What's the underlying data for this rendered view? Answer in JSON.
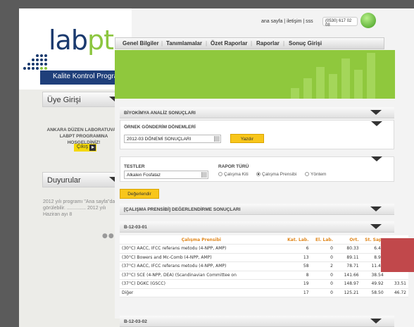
{
  "logo": {
    "lab": "lab",
    "pt": "pt",
    "subtitle": "Kalite Kontrol Programı"
  },
  "header": {
    "links": "ana sayfa | iletişim | sss",
    "phone": "(0530) 617 02 08"
  },
  "nav": [
    "Genel Bilgiler",
    "Tanımlamalar",
    "Özet Raporlar",
    "Raporlar",
    "Sonuç Girişi"
  ],
  "sidebar": {
    "uye_title": "Üye Girişi",
    "welcome": "ANKARA DÜZEN LABORATUVARI LABPT PROGRAMINA HOŞGELDİNİZ!",
    "logout": "Çıkış",
    "duyurular_title": "Duyurular",
    "news": "2012 yılı programı \"Ana sayfa\"da görülebilir. .............. 2012 yılı Haziran ayı 8",
    "news_pager": "●●•"
  },
  "main": {
    "section_title": "BİYOKİMYA ANALİZ SONUÇLARI",
    "period_label": "ÖRNEK GÖNDERİM DÖNEMLERİ",
    "period_value": "2012-03 DÖNEMİ SONUÇLARI",
    "print_button": "Yazdır",
    "tests_label": "TESTLER",
    "test_value": "Alkalen Fosfataz",
    "report_type_label": "RAPOR TÜRÜ",
    "report_options": [
      "Çalışma Kiti",
      "Çalışma Prensibi",
      "Yöntem"
    ],
    "report_selected": "Çalışma Prensibi",
    "evaluate_button": "Değerlendir",
    "results_title": "[ÇALIŞMA PRENSİBİ] DEĞERLENDİRME SONUÇLARI",
    "group1": "B-12-03-01",
    "group2": "B-12-03-02"
  },
  "table": {
    "headers": [
      "Çalışma Prensibi",
      "Kat. Lab.",
      "El. Lab.",
      "Ort.",
      "St. Sap."
    ],
    "rows": [
      [
        "(30°C) AACC, IFCC referans metodu (4-NPP, AMP)",
        "6",
        "0",
        "80.33",
        "6.41",
        ""
      ],
      [
        "(30°C) Bowers and Mc-Comb (4-NPP, AMP)",
        "13",
        "0",
        "89.11",
        "8.94",
        ""
      ],
      [
        "(37°C) AACC, IFCC referans metodu (4-NPP, AMP)",
        "58",
        "2",
        "78.71",
        "11.44",
        ""
      ],
      [
        "(37°C) SCE (4-NPP, DEA) (Scandinavian Committee on",
        "8",
        "0",
        "141.66",
        "38.54",
        ""
      ],
      [
        "(37°C) DGKC (GSCC)",
        "19",
        "0",
        "148.97",
        "49.92",
        "33.51"
      ],
      [
        "Diğer",
        "17",
        "0",
        "125.21",
        "58.50",
        "46.72"
      ]
    ]
  }
}
